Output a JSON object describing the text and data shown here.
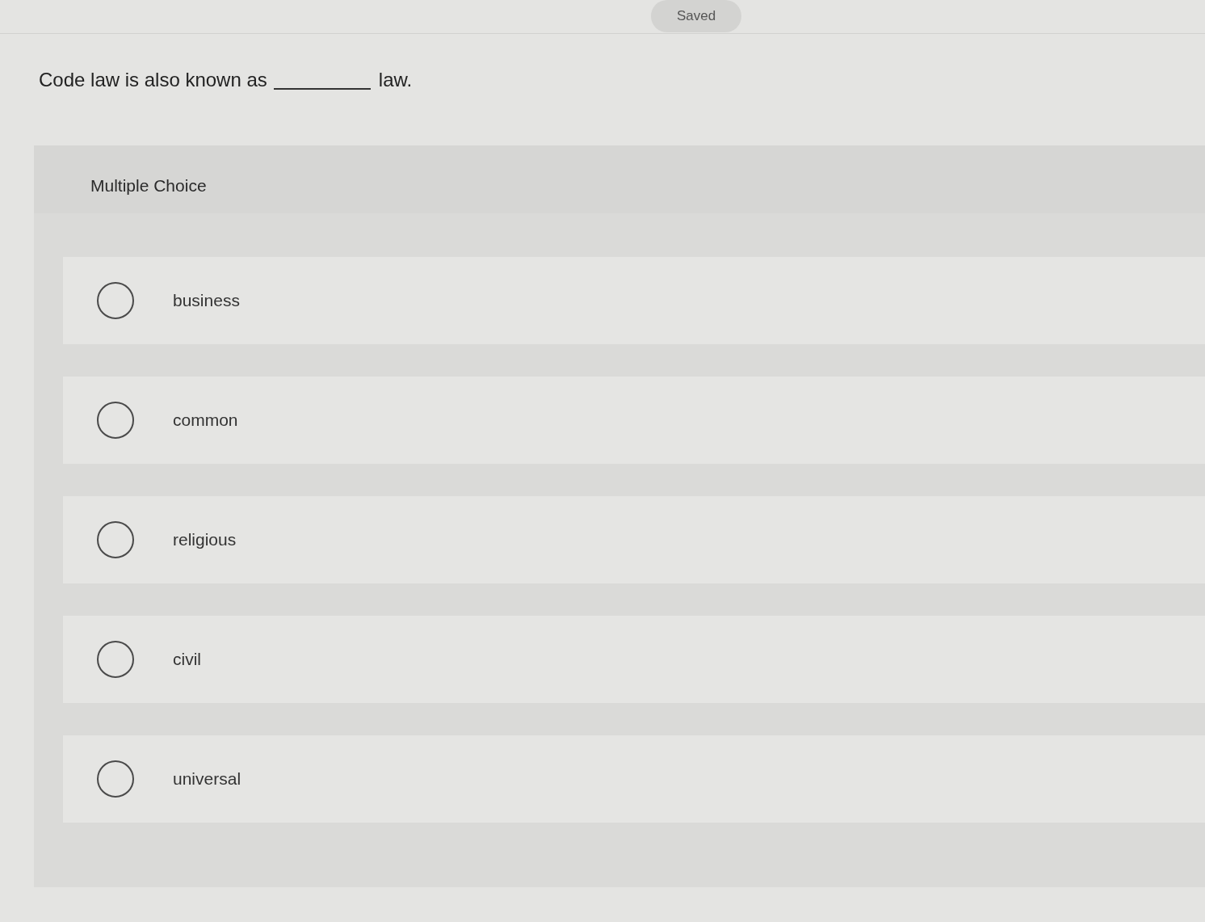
{
  "status_badge": "Saved",
  "question": {
    "before": "Code law is also known as",
    "after": "law."
  },
  "answer_panel": {
    "title": "Multiple Choice",
    "options": [
      {
        "label": "business",
        "selected": false
      },
      {
        "label": "common",
        "selected": false
      },
      {
        "label": "religious",
        "selected": false
      },
      {
        "label": "civil",
        "selected": false
      },
      {
        "label": "universal",
        "selected": false
      }
    ]
  }
}
